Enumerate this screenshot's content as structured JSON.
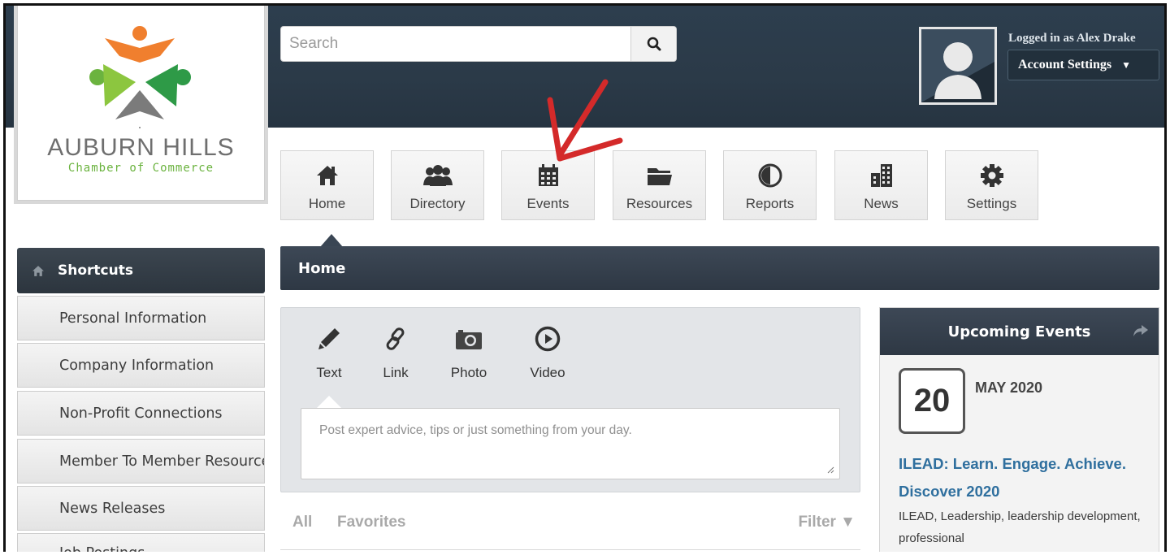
{
  "logo": {
    "title": "AUBURN HILLS",
    "subtitle": "Chamber of Commerce"
  },
  "search": {
    "placeholder": "Search",
    "icon": "search-icon"
  },
  "user": {
    "logged_in_text": "Logged in as Alex Drake",
    "account_label": "Account Settings"
  },
  "nav": {
    "items": [
      {
        "label": "Home",
        "icon": "home-icon"
      },
      {
        "label": "Directory",
        "icon": "people-icon"
      },
      {
        "label": "Events",
        "icon": "calendar-icon"
      },
      {
        "label": "Resources",
        "icon": "folder-icon"
      },
      {
        "label": "Reports",
        "icon": "pie-chart-icon"
      },
      {
        "label": "News",
        "icon": "building-icon"
      },
      {
        "label": "Settings",
        "icon": "gear-icon"
      }
    ],
    "active": "Home"
  },
  "sidebar": {
    "header": "Shortcuts",
    "items": [
      {
        "label": "Personal Information"
      },
      {
        "label": "Company Information"
      },
      {
        "label": "Non-Profit Connections"
      },
      {
        "label": "Member To Member Resources"
      },
      {
        "label": "News Releases"
      },
      {
        "label": "Job Postings"
      }
    ]
  },
  "main": {
    "section_title": "Home",
    "post_types": [
      {
        "label": "Text",
        "icon": "pencil-icon"
      },
      {
        "label": "Link",
        "icon": "link-icon"
      },
      {
        "label": "Photo",
        "icon": "camera-icon"
      },
      {
        "label": "Video",
        "icon": "play-icon"
      }
    ],
    "post_placeholder": "Post expert advice, tips or just something from your day.",
    "filters": {
      "all": "All",
      "favorites": "Favorites",
      "filter": "Filter ▼"
    }
  },
  "events": {
    "title": "Upcoming Events",
    "items": [
      {
        "day": "20",
        "month_year": "MAY 2020",
        "title": "ILEAD: Learn. Engage. Achieve. Discover 2020",
        "tags": "ILEAD, Leadership, leadership development, professional"
      }
    ]
  },
  "colors": {
    "header_bg": "#2d3e4e",
    "accent_link": "#2f6f9e",
    "annotation_arrow": "#d42a2a"
  }
}
